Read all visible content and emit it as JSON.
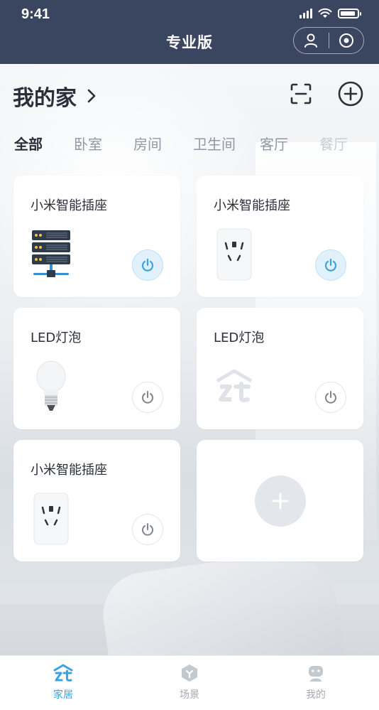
{
  "status_bar": {
    "time": "9:41"
  },
  "nav": {
    "title": "专业版"
  },
  "home": {
    "title": "我的家"
  },
  "tabs": [
    {
      "label": "全部",
      "active": true
    },
    {
      "label": "卧室"
    },
    {
      "label": "房间"
    },
    {
      "label": "卫生间"
    },
    {
      "label": "客厅"
    },
    {
      "label": "餐厅"
    }
  ],
  "devices": [
    {
      "name": "小米智能插座",
      "icon": "server-rack-icon",
      "power_on": true
    },
    {
      "name": "小米智能插座",
      "icon": "smart-plug-icon",
      "power_on": true
    },
    {
      "name": "LED灯泡",
      "icon": "light-bulb-icon",
      "power_on": false
    },
    {
      "name": "LED灯泡",
      "icon": "placeholder-logo-icon",
      "power_on": false
    },
    {
      "name": "小米智能插座",
      "icon": "smart-plug-icon",
      "power_on": false
    }
  ],
  "tabbar": [
    {
      "label": "家居",
      "icon": "home-logo-icon",
      "active": true
    },
    {
      "label": "场景",
      "icon": "scene-icon"
    },
    {
      "label": "我的",
      "icon": "profile-icon"
    }
  ],
  "colors": {
    "header": "#3a4560",
    "accent": "#3aa3e2",
    "card": "#ffffff"
  }
}
